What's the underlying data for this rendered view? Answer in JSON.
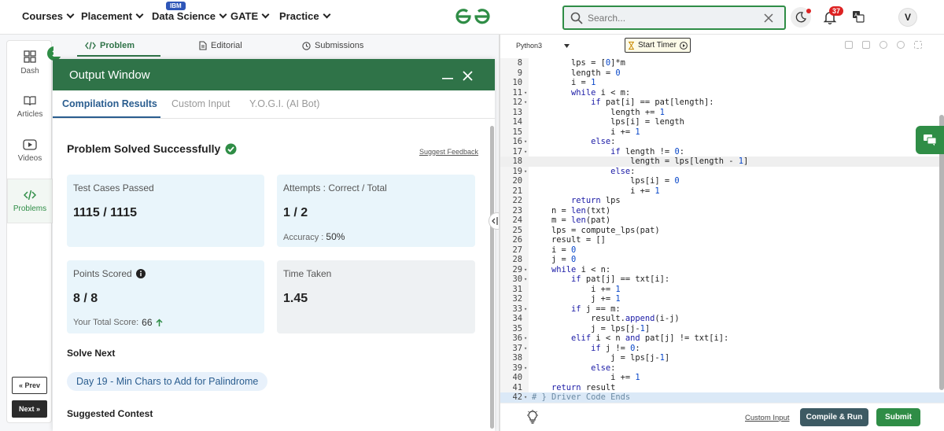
{
  "nav": {
    "items": [
      "Courses",
      "Placement",
      "Data Science",
      "GATE",
      "Practice"
    ],
    "ibm_badge": "IBM",
    "search_placeholder": "Search...",
    "notifications_count": "37",
    "avatar_initial": "V"
  },
  "sidebar": {
    "items": [
      "Dash",
      "Articles",
      "Videos",
      "Problems"
    ],
    "prev": "« Prev",
    "next": "Next »"
  },
  "problem_tabs": [
    "Problem",
    "Editorial",
    "Submissions"
  ],
  "output": {
    "title": "Output Window",
    "tabs": [
      "Compilation Results",
      "Custom Input",
      "Y.O.G.I. (AI Bot)"
    ],
    "status": "Problem Solved Successfully",
    "feedback": "Suggest Feedback",
    "cards": {
      "tests_label": "Test Cases Passed",
      "tests_value": "1115 / 1115",
      "attempts_label": "Attempts : Correct / Total",
      "attempts_value": "1 / 2",
      "accuracy_label": "Accuracy :",
      "accuracy_value": "50%",
      "points_label": "Points Scored",
      "points_value": "8 / 8",
      "total_label": "Your Total Score:",
      "total_value": "66",
      "time_label": "Time Taken",
      "time_value": "1.45"
    },
    "solve_next_label": "Solve Next",
    "solve_next_item": "Day 19 - Min Chars to Add for Palindrome",
    "suggested_contest": "Suggested Contest"
  },
  "editor": {
    "language": "Python3",
    "timer": "Start Timer",
    "highlight_line": 18,
    "lines": [
      {
        "n": 8,
        "f": false,
        "t": "        lps = [0]*m"
      },
      {
        "n": 9,
        "f": false,
        "t": "        length = 0"
      },
      {
        "n": 10,
        "f": false,
        "t": "        i = 1"
      },
      {
        "n": 11,
        "f": true,
        "t": "        while i < m:"
      },
      {
        "n": 12,
        "f": true,
        "t": "            if pat[i] == pat[length]:"
      },
      {
        "n": 13,
        "f": false,
        "t": "                length += 1"
      },
      {
        "n": 14,
        "f": false,
        "t": "                lps[i] = length"
      },
      {
        "n": 15,
        "f": false,
        "t": "                i += 1"
      },
      {
        "n": 16,
        "f": true,
        "t": "            else:"
      },
      {
        "n": 17,
        "f": true,
        "t": "                if length != 0:"
      },
      {
        "n": 18,
        "f": false,
        "t": "                    length = lps[length - 1]"
      },
      {
        "n": 19,
        "f": true,
        "t": "                else:"
      },
      {
        "n": 20,
        "f": false,
        "t": "                    lps[i] = 0"
      },
      {
        "n": 21,
        "f": false,
        "t": "                    i += 1"
      },
      {
        "n": 22,
        "f": false,
        "t": "        return lps"
      },
      {
        "n": 23,
        "f": false,
        "t": "    n = len(txt)"
      },
      {
        "n": 24,
        "f": false,
        "t": "    m = len(pat)"
      },
      {
        "n": 25,
        "f": false,
        "t": "    lps = compute_lps(pat)"
      },
      {
        "n": 26,
        "f": false,
        "t": "    result = []"
      },
      {
        "n": 27,
        "f": false,
        "t": "    i = 0"
      },
      {
        "n": 28,
        "f": false,
        "t": "    j = 0"
      },
      {
        "n": 29,
        "f": true,
        "t": "    while i < n:"
      },
      {
        "n": 30,
        "f": true,
        "t": "        if pat[j] == txt[i]:"
      },
      {
        "n": 31,
        "f": false,
        "t": "            i += 1"
      },
      {
        "n": 32,
        "f": false,
        "t": "            j += 1"
      },
      {
        "n": 33,
        "f": true,
        "t": "        if j == m:"
      },
      {
        "n": 34,
        "f": false,
        "t": "            result.append(i-j)"
      },
      {
        "n": 35,
        "f": false,
        "t": "            j = lps[j-1]"
      },
      {
        "n": 36,
        "f": true,
        "t": "        elif i < n and pat[j] != txt[i]:"
      },
      {
        "n": 37,
        "f": true,
        "t": "            if j != 0:"
      },
      {
        "n": 38,
        "f": false,
        "t": "                j = lps[j-1]"
      },
      {
        "n": 39,
        "f": true,
        "t": "            else:"
      },
      {
        "n": 40,
        "f": false,
        "t": "                i += 1"
      },
      {
        "n": 41,
        "f": false,
        "t": "    return result"
      },
      {
        "n": 42,
        "f": true,
        "t": "# } Driver Code Ends"
      }
    ],
    "custom_input": "Custom Input",
    "compile_run": "Compile & Run",
    "submit": "Submit"
  },
  "colors": {
    "brand_green": "#2f8d46",
    "header_green": "#2f7348",
    "card_blue": "#e9f5fb",
    "card_gray": "#eef1f3",
    "link_blue": "#2a5d8f"
  }
}
